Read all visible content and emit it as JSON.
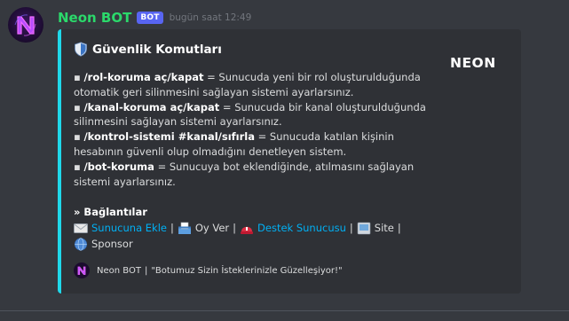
{
  "message": {
    "username": "Neon BOT",
    "bot_tag": "BOT",
    "timestamp": "bugün saat 12:49"
  },
  "embed": {
    "accent_color": "#1fd8ea",
    "title": "Güvenlik Komutları",
    "title_icon": "shield-icon",
    "thumbnail_text": "NEON",
    "commands": [
      {
        "bullet": "▪",
        "command": "/rol-koruma aç/kapat",
        "description_lines": [
          "= Sunucuda yeni bir rol oluşturulduğunda",
          "otomatik geri silinmesini sağlayan sistemi ayarlarsınız."
        ]
      },
      {
        "bullet": "▪",
        "command": "/kanal-koruma aç/kapat",
        "description_lines": [
          "= Sunucuda bir kanal oluşturulduğunda",
          "silinmesini sağlayan sistemi ayarlarsınız."
        ]
      },
      {
        "bullet": "▪",
        "command": "/kontrol-sistemi #kanal/sıfırla",
        "description_lines": [
          "= Sunucuda katılan kişinin",
          "hesabının güvenli olup olmadığını denetleyen sistem."
        ]
      },
      {
        "bullet": "▪",
        "command": "/bot-koruma",
        "description_lines": [
          "= Sunucuya bot eklendiğinde, atılmasını sağlayan",
          "sistemi ayarlarsınız."
        ]
      }
    ],
    "links_title": "» Bağlantılar",
    "links": {
      "add_server": "Sunucuna Ekle",
      "vote": "Oy Ver",
      "support_server": "Destek Sunucusu",
      "site": "Site",
      "sponsor": "Sponsor",
      "separator": "|"
    },
    "footer": {
      "name": "Neon BOT",
      "separator": "|",
      "text": "\"Botumuz Sizin İsteklerinizle Güzelleşiyor!\""
    }
  },
  "colors": {
    "background": "#36393f",
    "embed_background": "#2f3136",
    "username": "#2bd96b",
    "link": "#00b0f4",
    "bot_tag": "#5865f2"
  }
}
